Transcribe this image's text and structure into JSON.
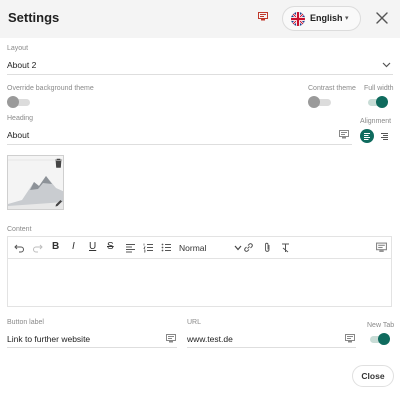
{
  "header": {
    "title": "Settings",
    "language": {
      "label": "English",
      "flag_icon": "uk-flag-icon"
    },
    "close_icon": "close-icon"
  },
  "layout": {
    "label": "Layout",
    "value": "About 2"
  },
  "override_theme": {
    "label": "Override background theme",
    "enabled": false
  },
  "contrast_theme": {
    "label": "Contrast theme",
    "enabled": false
  },
  "full_width": {
    "label": "Full width",
    "enabled": true
  },
  "heading": {
    "label": "Heading",
    "value": "About"
  },
  "alignment": {
    "label": "Alignment",
    "options": [
      "left",
      "right"
    ],
    "selected": "left"
  },
  "image": {
    "icons": [
      "delete-icon",
      "edit-icon"
    ]
  },
  "content": {
    "label": "Content",
    "toolbar": {
      "block_format": "Normal",
      "buttons": [
        "undo",
        "redo",
        "bold",
        "italic",
        "underline",
        "strikethrough",
        "align-left",
        "numbered-list",
        "bullet-list",
        "link",
        "attachment",
        "clear-format",
        "translate"
      ]
    },
    "value": ""
  },
  "button_label": {
    "label": "Button label",
    "value": "Link to further website"
  },
  "url": {
    "label": "URL",
    "value": "www.test.de"
  },
  "new_tab": {
    "label": "New Tab",
    "enabled": true
  },
  "footer": {
    "close_label": "Close"
  },
  "colors": {
    "accent": "#0f6b5e",
    "toggle_off": "#9a9a9a",
    "header_bg": "#f4f4f4"
  }
}
